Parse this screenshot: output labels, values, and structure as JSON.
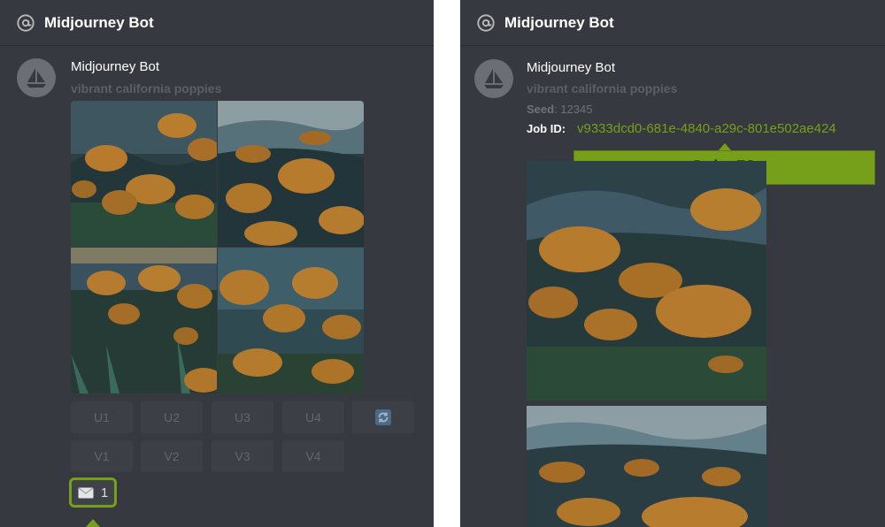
{
  "left": {
    "channel": "Midjourney Bot",
    "author": "Midjourney Bot",
    "prompt": "vibrant california poppies",
    "upscale_buttons": [
      "U1",
      "U2",
      "U3",
      "U4"
    ],
    "variation_buttons": [
      "V1",
      "V2",
      "V3",
      "V4"
    ],
    "reaction_count": "1",
    "icons": {
      "channel": "at-sign-icon",
      "avatar": "sailboat-icon",
      "reroll": "refresh-icon",
      "reaction": "envelope-icon"
    }
  },
  "right": {
    "channel": "Midjourney Bot",
    "author": "Midjourney Bot",
    "prompt": "vibrant california poppies",
    "seed_label": "Seed",
    "seed_value": ": 12345",
    "jobid_label": "Job ID",
    "jobid_value": "v9333dcd0-681e-4840-a29c-801e502ae424",
    "callout": "Job ID"
  },
  "colors": {
    "panel": "#36393f",
    "accent": "#76a019",
    "dim_text": "#5c5f65",
    "button": "#3c3f45"
  }
}
